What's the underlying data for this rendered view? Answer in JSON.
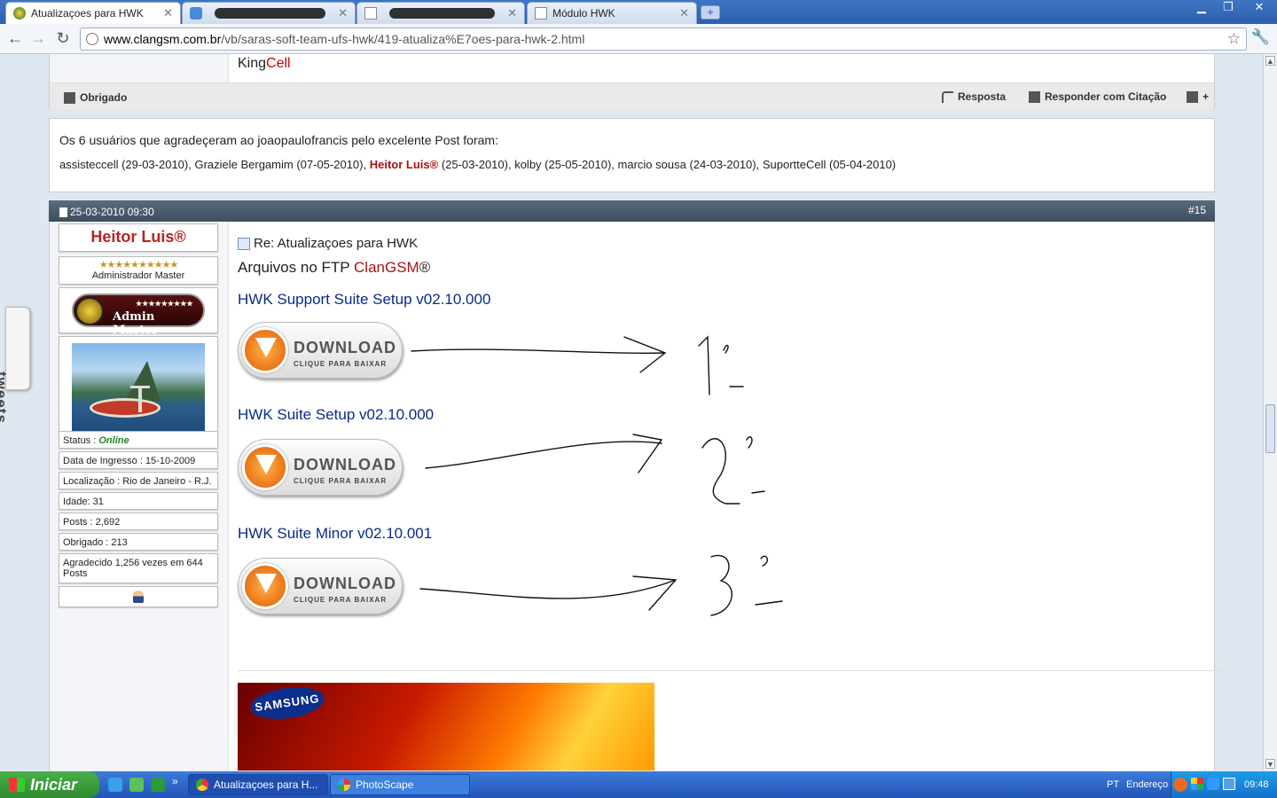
{
  "browser": {
    "tabs": [
      {
        "label": "Atualizaçoes para HWK",
        "active": true
      },
      {
        "label": "",
        "redacted": true
      },
      {
        "label": "",
        "redacted": true
      },
      {
        "label": "Módulo HWK",
        "active": false
      }
    ],
    "new_tab": "+",
    "url_host": "www.clangsm.com.br",
    "url_path": "/vb/saras-soft-team-ufs-hwk/419-atualiza%E7oes-para-hwk-2.html"
  },
  "tweets_label": "tweets",
  "prev_post": {
    "signature_a": "King",
    "signature_b": "Cell",
    "thanks_button": "Obrigado",
    "reply_button": "Resposta",
    "quote_button": "Responder com Citação"
  },
  "thanks": {
    "heading": "Os 6 usuários que agradeçeram ao joaopaulofrancis pelo excelente Post foram:",
    "list_a": "assisteccell (29-03-2010), Graziele Bergamim (07-05-2010), ",
    "list_highlight": "Heitor Luis®",
    "list_b": " (25-03-2010), kolby (25-05-2010), marcio sousa (24-03-2010), SuportteCell (05-04-2010)"
  },
  "post": {
    "date": "25-03-2010 09:30",
    "number": "#15",
    "user": {
      "name": "Heitor Luis®",
      "stars": "★★★★★★★★★★",
      "role": "Administrador Master",
      "badge_stars": "★★★★★★★★★",
      "badge_text": "Admin Master",
      "status_label": "Status : ",
      "status_value": "Online",
      "joined": "Data de Ingresso : 15-10-2009",
      "location": "Localização : Rio de Janeiro - R.J.",
      "age": "Idade: 31",
      "posts": "Posts : 2,692",
      "thanked": "Obrigado : 213",
      "thanks_received": "Agradecido 1,256 vezes em 644 Posts"
    },
    "title": "Re: Atualizaçoes para HWK",
    "ftp_prefix": "Arquivos no FTP ",
    "ftp_brand": "ClanGSM",
    "ftp_suffix": "®",
    "files": [
      {
        "name": "HWK Support Suite Setup v02.10.000",
        "download": "DOWNLOAD",
        "download_sub": "CLIQUE PARA BAIXAR"
      },
      {
        "name": "HWK Suite Setup v02.10.000",
        "download": "DOWNLOAD",
        "download_sub": "CLIQUE PARA BAIXAR"
      },
      {
        "name": "HWK Suite Minor v02.10.001",
        "download": "DOWNLOAD",
        "download_sub": "CLIQUE PARA BAIXAR"
      }
    ],
    "ad_logo": "SAMSUNG"
  },
  "taskbar": {
    "start": "Iniciar",
    "tasks": [
      {
        "label": "Atualizaçoes para H...",
        "active": true
      },
      {
        "label": "PhotoScape",
        "active": false
      }
    ],
    "lang": "PT",
    "address_label": "Endereço",
    "clock": "09:48"
  }
}
